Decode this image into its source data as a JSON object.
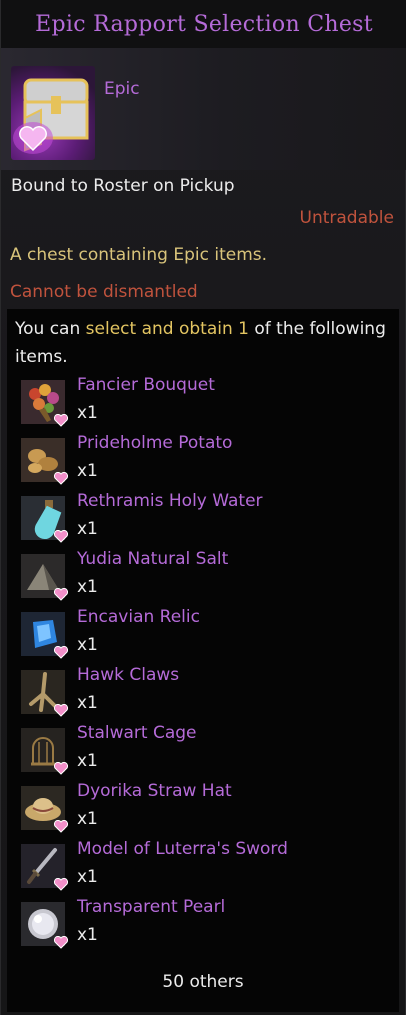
{
  "title": "Epic Rapport Selection Chest",
  "grade": "Epic",
  "bound": "Bound to Roster on Pickup",
  "tradability": "Untradable",
  "description": "A chest containing Epic items.",
  "dismantle": "Cannot be dismantled",
  "selection": {
    "prefix": "You can",
    "highlight": "select and obtain 1",
    "suffix": "of the following items."
  },
  "items": [
    {
      "name": "Fancier Bouquet",
      "qty": "x1",
      "icon": "bouquet-icon"
    },
    {
      "name": "Prideholme Potato",
      "qty": "x1",
      "icon": "potato-icon"
    },
    {
      "name": "Rethramis Holy Water",
      "qty": "x1",
      "icon": "holy-water-icon"
    },
    {
      "name": "Yudia Natural Salt",
      "qty": "x1",
      "icon": "salt-icon"
    },
    {
      "name": "Encavian Relic",
      "qty": "x1",
      "icon": "relic-icon"
    },
    {
      "name": "Hawk Claws",
      "qty": "x1",
      "icon": "hawk-claws-icon"
    },
    {
      "name": "Stalwart Cage",
      "qty": "x1",
      "icon": "cage-icon"
    },
    {
      "name": "Dyorika Straw Hat",
      "qty": "x1",
      "icon": "straw-hat-icon"
    },
    {
      "name": "Model of Luterra's Sword",
      "qty": "x1",
      "icon": "sword-icon"
    },
    {
      "name": "Transparent Pearl",
      "qty": "x1",
      "icon": "pearl-icon"
    }
  ],
  "others": "50 others",
  "colors": {
    "epic": "#b56bd8",
    "warning": "#c0533d",
    "description": "#d9c47b",
    "highlight": "#e3c562"
  }
}
